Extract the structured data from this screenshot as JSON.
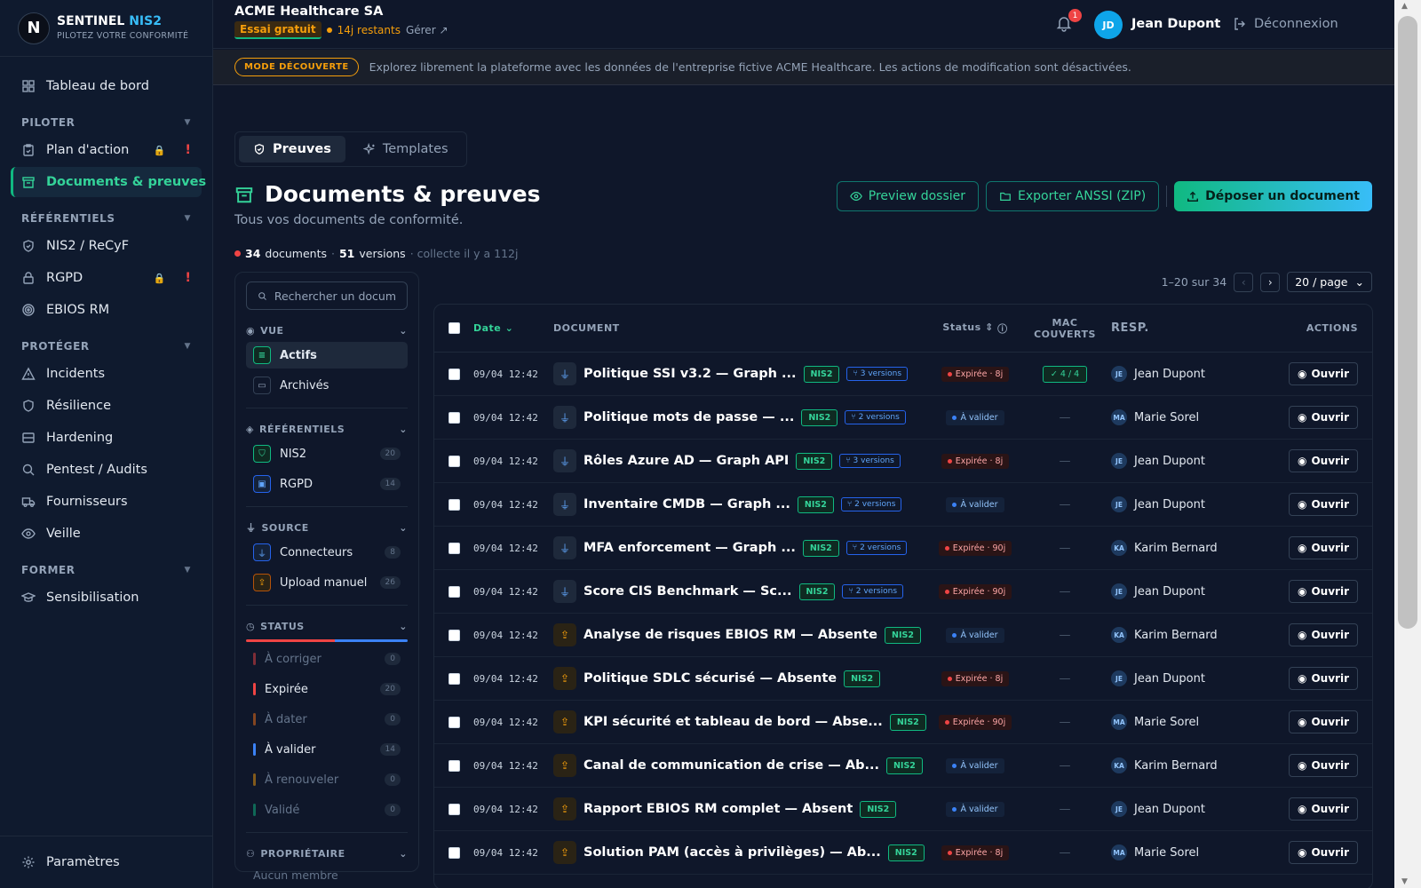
{
  "sidebar": {
    "brand": {
      "logo_letter": "N",
      "name": "SENTINEL",
      "name_accent": "NIS2",
      "tagline": "PILOTEZ VOTRE CONFORMITÉ"
    },
    "dashboard": "Tableau de bord",
    "sections": [
      {
        "label": "PILOTER"
      },
      {
        "label": "RÉFÉRENTIELS"
      },
      {
        "label": "PROTÉGER"
      },
      {
        "label": "FORMER"
      }
    ],
    "items": {
      "plan": "Plan d'action",
      "documents": "Documents & preuves",
      "nis2": "NIS2 / ReCyF",
      "rgpd": "RGPD",
      "ebios": "EBIOS RM",
      "incidents": "Incidents",
      "resilience": "Résilience",
      "hardening": "Hardening",
      "pentest": "Pentest / Audits",
      "suppliers": "Fournisseurs",
      "watch": "Veille",
      "awareness": "Sensibilisation"
    },
    "settings": "Paramètres"
  },
  "header": {
    "org": "ACME Healthcare SA",
    "trial_badge": "Essai gratuit",
    "remaining": "14j restants",
    "manage": "Gérer",
    "notifications": "1",
    "user_initials": "JD",
    "user_name": "Jean Dupont",
    "logout": "Déconnexion"
  },
  "banner": {
    "badge": "MODE DÉCOUVERTE",
    "text": "Explorez librement la plateforme avec les données de l'entreprise fictive ACME Healthcare. Les actions de modification sont désactivées."
  },
  "tabs": [
    "Preuves",
    "Templates"
  ],
  "page": {
    "title": "Documents & preuves",
    "subtitle": "Tous vos documents de conformité.",
    "btn_preview": "Preview dossier",
    "btn_export": "Exporter ANSSI (ZIP)",
    "btn_upload": "Déposer un document",
    "stats": {
      "docs": "34",
      "docs_label": "documents",
      "sep": "·",
      "versions": "51",
      "versions_label": "versions",
      "collected": "· collecte il y a 112j"
    }
  },
  "filters": {
    "search_placeholder": "Rechercher un docum",
    "view_label": "VUE",
    "view_items": [
      "Actifs",
      "Archivés"
    ],
    "ref_label": "RÉFÉRENTIELS",
    "ref_items": [
      {
        "label": "NIS2",
        "count": "20"
      },
      {
        "label": "RGPD",
        "count": "14"
      }
    ],
    "source_label": "SOURCE",
    "source_items": [
      {
        "label": "Connecteurs",
        "count": "8"
      },
      {
        "label": "Upload manuel",
        "count": "26"
      }
    ],
    "status_label": "STATUS",
    "status_items": [
      {
        "label": "À corriger",
        "count": "0",
        "color": "#ef4444"
      },
      {
        "label": "Expirée",
        "count": "20",
        "color": "#ef4444"
      },
      {
        "label": "À dater",
        "count": "0",
        "color": "#f97316"
      },
      {
        "label": "À valider",
        "count": "14",
        "color": "#3b82f6"
      },
      {
        "label": "À renouveler",
        "count": "0",
        "color": "#f59e0b"
      },
      {
        "label": "Validé",
        "count": "0",
        "color": "#10b981"
      }
    ],
    "owner_label": "PROPRIÉTAIRE",
    "owner_empty": "Aucun membre"
  },
  "pager": {
    "range": "1–20 sur 34",
    "per_page": "20 / page"
  },
  "table": {
    "headers": {
      "date": "Date",
      "document": "DOCUMENT",
      "status": "Status",
      "mac": "MAC COUVERTS",
      "resp": "RESP.",
      "actions": "ACTIONS"
    },
    "open_label": "Ouvrir",
    "rows": [
      {
        "date": "09/04 12:42",
        "source": "connector",
        "title": "Politique SSI v3.2 — Graph ...",
        "tag": "NIS2",
        "versions": "3 versions",
        "status": "Expirée · 8j",
        "status_type": "exp",
        "mac": "4 / 4",
        "resp_initials": "JE",
        "resp": "Jean Dupont"
      },
      {
        "date": "09/04 12:42",
        "source": "connector",
        "title": "Politique mots de passe — ...",
        "tag": "NIS2",
        "versions": "2 versions",
        "status": "À valider",
        "status_type": "val",
        "mac": "—",
        "resp_initials": "MA",
        "resp": "Marie Sorel"
      },
      {
        "date": "09/04 12:42",
        "source": "connector",
        "title": "Rôles Azure AD — Graph API",
        "tag": "NIS2",
        "versions": "3 versions",
        "status": "Expirée · 8j",
        "status_type": "exp",
        "mac": "—",
        "resp_initials": "JE",
        "resp": "Jean Dupont"
      },
      {
        "date": "09/04 12:42",
        "source": "connector",
        "title": "Inventaire CMDB — Graph ...",
        "tag": "NIS2",
        "versions": "2 versions",
        "status": "À valider",
        "status_type": "val",
        "mac": "—",
        "resp_initials": "JE",
        "resp": "Jean Dupont"
      },
      {
        "date": "09/04 12:42",
        "source": "connector",
        "title": "MFA enforcement — Graph ...",
        "tag": "NIS2",
        "versions": "2 versions",
        "status": "Expirée · 90j",
        "status_type": "exp",
        "mac": "—",
        "resp_initials": "KA",
        "resp": "Karim Bernard"
      },
      {
        "date": "09/04 12:42",
        "source": "connector",
        "title": "Score CIS Benchmark — Sc...",
        "tag": "NIS2",
        "versions": "2 versions",
        "status": "Expirée · 90j",
        "status_type": "exp",
        "mac": "—",
        "resp_initials": "JE",
        "resp": "Jean Dupont"
      },
      {
        "date": "09/04 12:42",
        "source": "upload",
        "title": "Analyse de risques EBIOS RM — Absente",
        "tag": "NIS2",
        "versions": "",
        "status": "À valider",
        "status_type": "val",
        "mac": "—",
        "resp_initials": "KA",
        "resp": "Karim Bernard"
      },
      {
        "date": "09/04 12:42",
        "source": "upload",
        "title": "Politique SDLC sécurisé — Absente",
        "tag": "NIS2",
        "versions": "",
        "status": "Expirée · 8j",
        "status_type": "exp",
        "mac": "—",
        "resp_initials": "JE",
        "resp": "Jean Dupont"
      },
      {
        "date": "09/04 12:42",
        "source": "upload",
        "title": "KPI sécurité et tableau de bord — Abse...",
        "tag": "NIS2",
        "versions": "",
        "status": "Expirée · 90j",
        "status_type": "exp",
        "mac": "—",
        "resp_initials": "MA",
        "resp": "Marie Sorel"
      },
      {
        "date": "09/04 12:42",
        "source": "upload",
        "title": "Canal de communication de crise — Ab...",
        "tag": "NIS2",
        "versions": "",
        "status": "À valider",
        "status_type": "val",
        "mac": "—",
        "resp_initials": "KA",
        "resp": "Karim Bernard"
      },
      {
        "date": "09/04 12:42",
        "source": "upload",
        "title": "Rapport EBIOS RM complet — Absent",
        "tag": "NIS2",
        "versions": "",
        "status": "À valider",
        "status_type": "val",
        "mac": "—",
        "resp_initials": "JE",
        "resp": "Jean Dupont"
      },
      {
        "date": "09/04 12:42",
        "source": "upload",
        "title": "Solution PAM (accès à privilèges) — Ab...",
        "tag": "NIS2",
        "versions": "",
        "status": "Expirée · 8j",
        "status_type": "exp",
        "mac": "—",
        "resp_initials": "MA",
        "resp": "Marie Sorel"
      }
    ]
  }
}
